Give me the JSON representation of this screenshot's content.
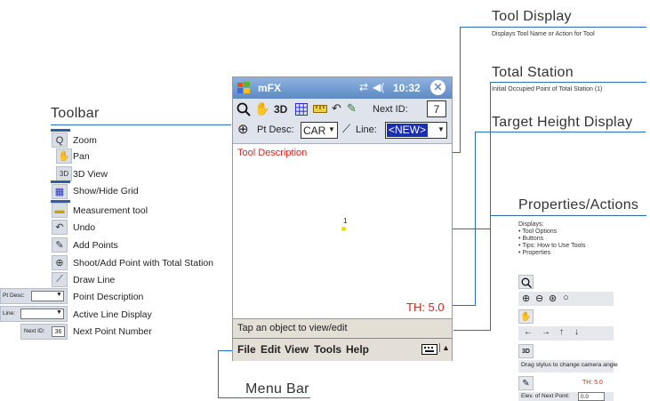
{
  "callouts": {
    "tool_display": {
      "title": "Tool Display",
      "sub": "Displays Tool Name or Action for Tool"
    },
    "total_station": {
      "title": "Total Station",
      "sub": "Initial Occupied Point of Total Station (1)"
    },
    "target_height": {
      "title": "Target Height Display"
    },
    "properties": {
      "title": "Properties/Actions",
      "displays": "Displays:",
      "bullets": [
        "• Tool Options",
        "• Buttons",
        "• Tips: How to Use Tools",
        "• Properties"
      ]
    },
    "toolbar": {
      "title": "Toolbar"
    },
    "menu_bar": {
      "title": "Menu Bar"
    }
  },
  "legend": [
    {
      "icon": "Q",
      "label": "Zoom"
    },
    {
      "icon": "✋",
      "label": "Pan"
    },
    {
      "icon": "3D",
      "label": "3D View"
    },
    {
      "icon": "▦",
      "label": "Show/Hide Grid"
    },
    {
      "icon": "▬",
      "label": "Measurement tool"
    },
    {
      "icon": "↶",
      "label": "Undo"
    },
    {
      "icon": "✎",
      "label": "Add Points"
    },
    {
      "icon": "⊕",
      "label": "Shoot/Add Point with Total Station"
    },
    {
      "icon": "⟋",
      "label": "Draw Line"
    },
    {
      "icon": "",
      "label": "Point Description"
    },
    {
      "icon": "",
      "label": "Active Line Display"
    },
    {
      "icon": "36",
      "label": "Next Point Number"
    }
  ],
  "legend_fields": {
    "pt_desc": "Pt Desc:",
    "line": "Line:",
    "next_id": "Next ID:",
    "next_id_value": "36"
  },
  "device": {
    "app_name": "mFX",
    "time": "10:32",
    "toolbar": {
      "three_d": "3D",
      "next_id_label": "Next ID:",
      "next_id_value": "7",
      "pt_desc_label": "Pt Desc:",
      "pt_desc_value": "CAR",
      "line_label": "Line:",
      "line_value": "<NEW>"
    },
    "tool_description": "Tool Description",
    "point_label": "1",
    "th": "TH: 5.0",
    "status": "Tap an object to view/edit",
    "menu": [
      "File",
      "Edit",
      "View",
      "Tools",
      "Help"
    ]
  },
  "props_panel": {
    "nav": [
      "←",
      "→",
      "↑",
      "↓"
    ],
    "three_d": "3D",
    "hint": "Drag stylus to change camera angle",
    "th": "TH: 5.0",
    "elev_label": "Elev. of Next Point:",
    "elev_value": "0.0"
  },
  "colors": {
    "accent": "#2a6cb5",
    "red": "#e0201b",
    "selection": "#1a2fb0"
  }
}
